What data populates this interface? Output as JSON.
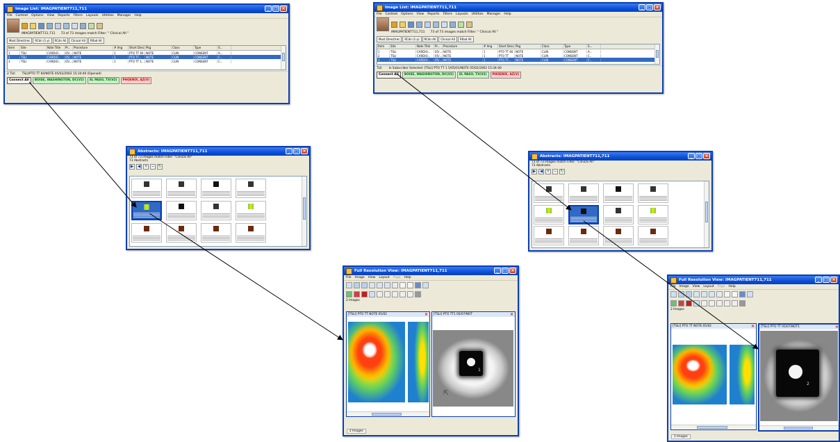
{
  "colors": {
    "titlebar": "#0a3fb6",
    "selection": "#316ac5",
    "connected_site": "#007000",
    "failed_site": "#d00000"
  },
  "image_list": {
    "title": "Image List: IMAGPATIENT711,711",
    "menu": [
      "File",
      "Context",
      "Options",
      "View",
      "Reports",
      "Filters",
      "Layouts",
      "Utilities",
      "Manager",
      "Help"
    ],
    "patient": "IMAGPATIENT711,711",
    "match_text": "73 of 73 images match Filter: \" Clinical All \"",
    "tabs": [
      "Most Direct/rec",
      "RCdn (1-y)",
      "RCdn All",
      "Clinical All",
      "RRad All"
    ],
    "columns": [
      "Item",
      "Site",
      "Note Title",
      "Pr...",
      "Procedure",
      "# Img",
      "Short Desc",
      "Pkg",
      "Class",
      "Type",
      "S..."
    ],
    "left_rows": [
      [
        "1",
        "TSLI",
        "CARDIO...",
        "05/...",
        "NOTE",
        "1",
        "PTO TT 60",
        "NOTE",
        "CLIN",
        "CONSENT",
        "A..."
      ],
      [
        "2",
        "TSLI",
        "CARDIO...",
        "05/...",
        "NOTE",
        "1",
        "PTO TT...",
        "NOTE",
        "CLIN",
        "CONSENT",
        "C..."
      ],
      [
        "3",
        "TSLI",
        "CARDIO...",
        "05/...",
        "NOTE",
        "1",
        "PTO TT 1...",
        "NOTE",
        "CLIN",
        "CONSENT",
        "C..."
      ]
    ],
    "right_rows": [
      [
        "1",
        "TSLI",
        "CARDIO...",
        "05/...",
        "NOTE",
        "1",
        "PTO TT 60",
        "NOTE",
        "CLIN",
        "CONSENT",
        "A..."
      ],
      [
        "2",
        "TSLI",
        "CARDIO...",
        "05/...",
        "NOTE",
        "1",
        "PTO TT",
        "NOTE",
        "CLIN",
        "CONSENT",
        "C..."
      ],
      [
        "3",
        "TSLI",
        "CARDIO...",
        "05/...",
        "NOTE",
        "1",
        "PTO TT...",
        "NOTE",
        "CLIN",
        "CONSENT",
        "C..."
      ]
    ],
    "left_status": [
      "2 TLII",
      "TSLI/PTO TT 60/NOTE 05/02/2002 15:34:40 (Opened)"
    ],
    "right_status": [
      "TLII",
      "In Subscriber Selected: [TSLI] PTO TT 1 5/05/01/NOTE 05/02/2002 15:34:40"
    ],
    "connect_label": "Connect All",
    "sites": [
      {
        "label": "BOISE, WASHINGTON, DC(V2)",
        "state": "ok"
      },
      {
        "label": "EL PASO, TX(V2)",
        "state": "ok"
      },
      {
        "label": "PHOENIX, AZ(V)",
        "state": "bad"
      }
    ]
  },
  "abstracts": {
    "title": "Abstracts: IMAGPATIENT711,711",
    "info1": "73 of 73 images match Filter: \"Clinical All\"",
    "info2": "73 Abstracts"
  },
  "full_res": {
    "title": "Full Resolution View: IMAGPATIENT711,711",
    "menu": [
      "File",
      "Image",
      "View",
      "Layout",
      "Page",
      "Help"
    ],
    "images_label": "2 Images",
    "left_window": {
      "pane1_title": "[TSLI] PTO TT NOTE 05/02",
      "pane2_title": "[TSLI] PTO TT1 05/07/NOT",
      "pane2_number": "1"
    },
    "right_window": {
      "pane1_title": "[TSLI] PTO TT NOTE 05/02",
      "pane2_title": "[TSLI] PTO TT 05/07/NOT1",
      "pane2_number": "2"
    },
    "status": "2 Images"
  }
}
